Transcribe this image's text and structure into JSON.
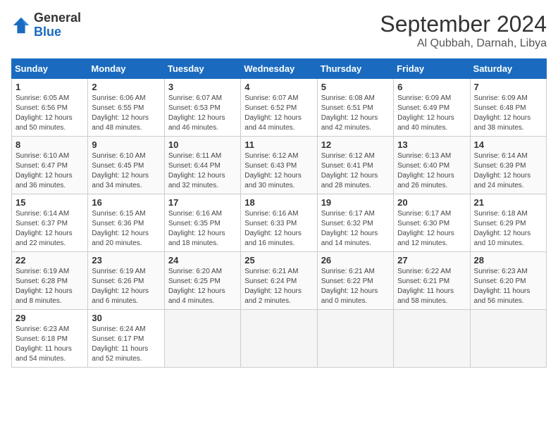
{
  "header": {
    "logo_general": "General",
    "logo_blue": "Blue",
    "month": "September 2024",
    "location": "Al Qubbah, Darnah, Libya"
  },
  "weekdays": [
    "Sunday",
    "Monday",
    "Tuesday",
    "Wednesday",
    "Thursday",
    "Friday",
    "Saturday"
  ],
  "weeks": [
    [
      {
        "day": "1",
        "sunrise": "6:05 AM",
        "sunset": "6:56 PM",
        "daylight": "12 hours and 50 minutes."
      },
      {
        "day": "2",
        "sunrise": "6:06 AM",
        "sunset": "6:55 PM",
        "daylight": "12 hours and 48 minutes."
      },
      {
        "day": "3",
        "sunrise": "6:07 AM",
        "sunset": "6:53 PM",
        "daylight": "12 hours and 46 minutes."
      },
      {
        "day": "4",
        "sunrise": "6:07 AM",
        "sunset": "6:52 PM",
        "daylight": "12 hours and 44 minutes."
      },
      {
        "day": "5",
        "sunrise": "6:08 AM",
        "sunset": "6:51 PM",
        "daylight": "12 hours and 42 minutes."
      },
      {
        "day": "6",
        "sunrise": "6:09 AM",
        "sunset": "6:49 PM",
        "daylight": "12 hours and 40 minutes."
      },
      {
        "day": "7",
        "sunrise": "6:09 AM",
        "sunset": "6:48 PM",
        "daylight": "12 hours and 38 minutes."
      }
    ],
    [
      {
        "day": "8",
        "sunrise": "6:10 AM",
        "sunset": "6:47 PM",
        "daylight": "12 hours and 36 minutes."
      },
      {
        "day": "9",
        "sunrise": "6:10 AM",
        "sunset": "6:45 PM",
        "daylight": "12 hours and 34 minutes."
      },
      {
        "day": "10",
        "sunrise": "6:11 AM",
        "sunset": "6:44 PM",
        "daylight": "12 hours and 32 minutes."
      },
      {
        "day": "11",
        "sunrise": "6:12 AM",
        "sunset": "6:43 PM",
        "daylight": "12 hours and 30 minutes."
      },
      {
        "day": "12",
        "sunrise": "6:12 AM",
        "sunset": "6:41 PM",
        "daylight": "12 hours and 28 minutes."
      },
      {
        "day": "13",
        "sunrise": "6:13 AM",
        "sunset": "6:40 PM",
        "daylight": "12 hours and 26 minutes."
      },
      {
        "day": "14",
        "sunrise": "6:14 AM",
        "sunset": "6:39 PM",
        "daylight": "12 hours and 24 minutes."
      }
    ],
    [
      {
        "day": "15",
        "sunrise": "6:14 AM",
        "sunset": "6:37 PM",
        "daylight": "12 hours and 22 minutes."
      },
      {
        "day": "16",
        "sunrise": "6:15 AM",
        "sunset": "6:36 PM",
        "daylight": "12 hours and 20 minutes."
      },
      {
        "day": "17",
        "sunrise": "6:16 AM",
        "sunset": "6:35 PM",
        "daylight": "12 hours and 18 minutes."
      },
      {
        "day": "18",
        "sunrise": "6:16 AM",
        "sunset": "6:33 PM",
        "daylight": "12 hours and 16 minutes."
      },
      {
        "day": "19",
        "sunrise": "6:17 AM",
        "sunset": "6:32 PM",
        "daylight": "12 hours and 14 minutes."
      },
      {
        "day": "20",
        "sunrise": "6:17 AM",
        "sunset": "6:30 PM",
        "daylight": "12 hours and 12 minutes."
      },
      {
        "day": "21",
        "sunrise": "6:18 AM",
        "sunset": "6:29 PM",
        "daylight": "12 hours and 10 minutes."
      }
    ],
    [
      {
        "day": "22",
        "sunrise": "6:19 AM",
        "sunset": "6:28 PM",
        "daylight": "12 hours and 8 minutes."
      },
      {
        "day": "23",
        "sunrise": "6:19 AM",
        "sunset": "6:26 PM",
        "daylight": "12 hours and 6 minutes."
      },
      {
        "day": "24",
        "sunrise": "6:20 AM",
        "sunset": "6:25 PM",
        "daylight": "12 hours and 4 minutes."
      },
      {
        "day": "25",
        "sunrise": "6:21 AM",
        "sunset": "6:24 PM",
        "daylight": "12 hours and 2 minutes."
      },
      {
        "day": "26",
        "sunrise": "6:21 AM",
        "sunset": "6:22 PM",
        "daylight": "12 hours and 0 minutes."
      },
      {
        "day": "27",
        "sunrise": "6:22 AM",
        "sunset": "6:21 PM",
        "daylight": "11 hours and 58 minutes."
      },
      {
        "day": "28",
        "sunrise": "6:23 AM",
        "sunset": "6:20 PM",
        "daylight": "11 hours and 56 minutes."
      }
    ],
    [
      {
        "day": "29",
        "sunrise": "6:23 AM",
        "sunset": "6:18 PM",
        "daylight": "11 hours and 54 minutes."
      },
      {
        "day": "30",
        "sunrise": "6:24 AM",
        "sunset": "6:17 PM",
        "daylight": "11 hours and 52 minutes."
      },
      null,
      null,
      null,
      null,
      null
    ]
  ]
}
